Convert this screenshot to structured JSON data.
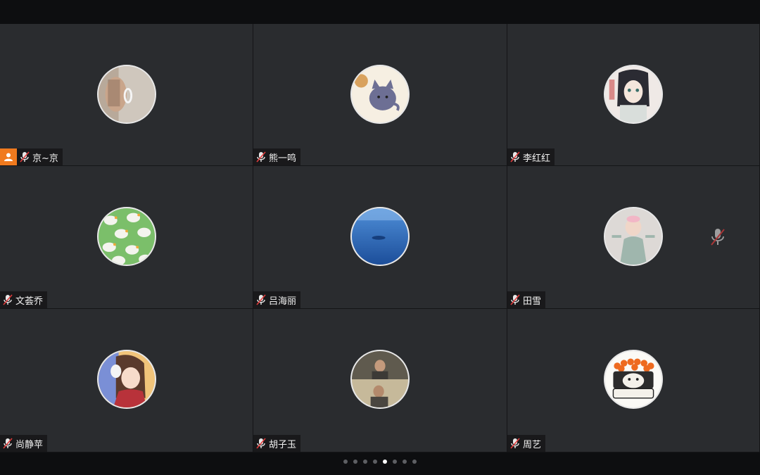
{
  "participants": [
    {
      "name": "京~京",
      "host": true
    },
    {
      "name": "熊一鸣"
    },
    {
      "name": "李红红"
    },
    {
      "name": "文荟乔"
    },
    {
      "name": "吕海丽"
    },
    {
      "name": "田雪"
    },
    {
      "name": "尚静苹"
    },
    {
      "name": "胡子玉"
    },
    {
      "name": "周艺"
    }
  ],
  "pagination": {
    "total": 8,
    "current": 5
  },
  "colors": {
    "host_badge": "#f07a1e",
    "mic_muted": "#e03b3b"
  },
  "icons": {
    "mic": "mic-muted-icon",
    "host": "host-person-icon"
  }
}
